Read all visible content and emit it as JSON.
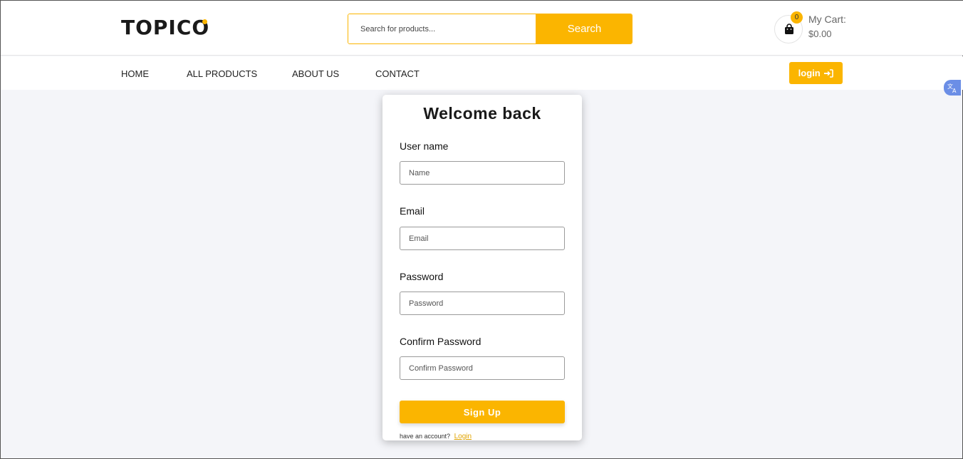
{
  "header": {
    "logo_text": "TOPICO",
    "search": {
      "placeholder": "Search for products...",
      "button_label": "Search"
    },
    "cart": {
      "count": "0",
      "label": "My Cart:",
      "total": "$0.00"
    }
  },
  "nav": {
    "items": [
      {
        "label": "HOME"
      },
      {
        "label": "ALL PRODUCTS"
      },
      {
        "label": "ABOUT US"
      },
      {
        "label": "CONTACT"
      }
    ],
    "login_label": "login"
  },
  "form": {
    "title": "Welcome back",
    "fields": [
      {
        "label": "User name",
        "placeholder": "Name"
      },
      {
        "label": "Email",
        "placeholder": "Email"
      },
      {
        "label": "Password",
        "placeholder": "Password"
      },
      {
        "label": "Confirm Password",
        "placeholder": "Confirm Password"
      }
    ],
    "submit_label": "Sign Up",
    "have_account_text": "have an account?",
    "login_link": "Login"
  },
  "colors": {
    "accent": "#fbb500",
    "background": "#f4f5f9",
    "translate": "#6b8ee6"
  },
  "icons": [
    "shopping-bag-icon",
    "sign-in-icon",
    "translate-icon"
  ]
}
